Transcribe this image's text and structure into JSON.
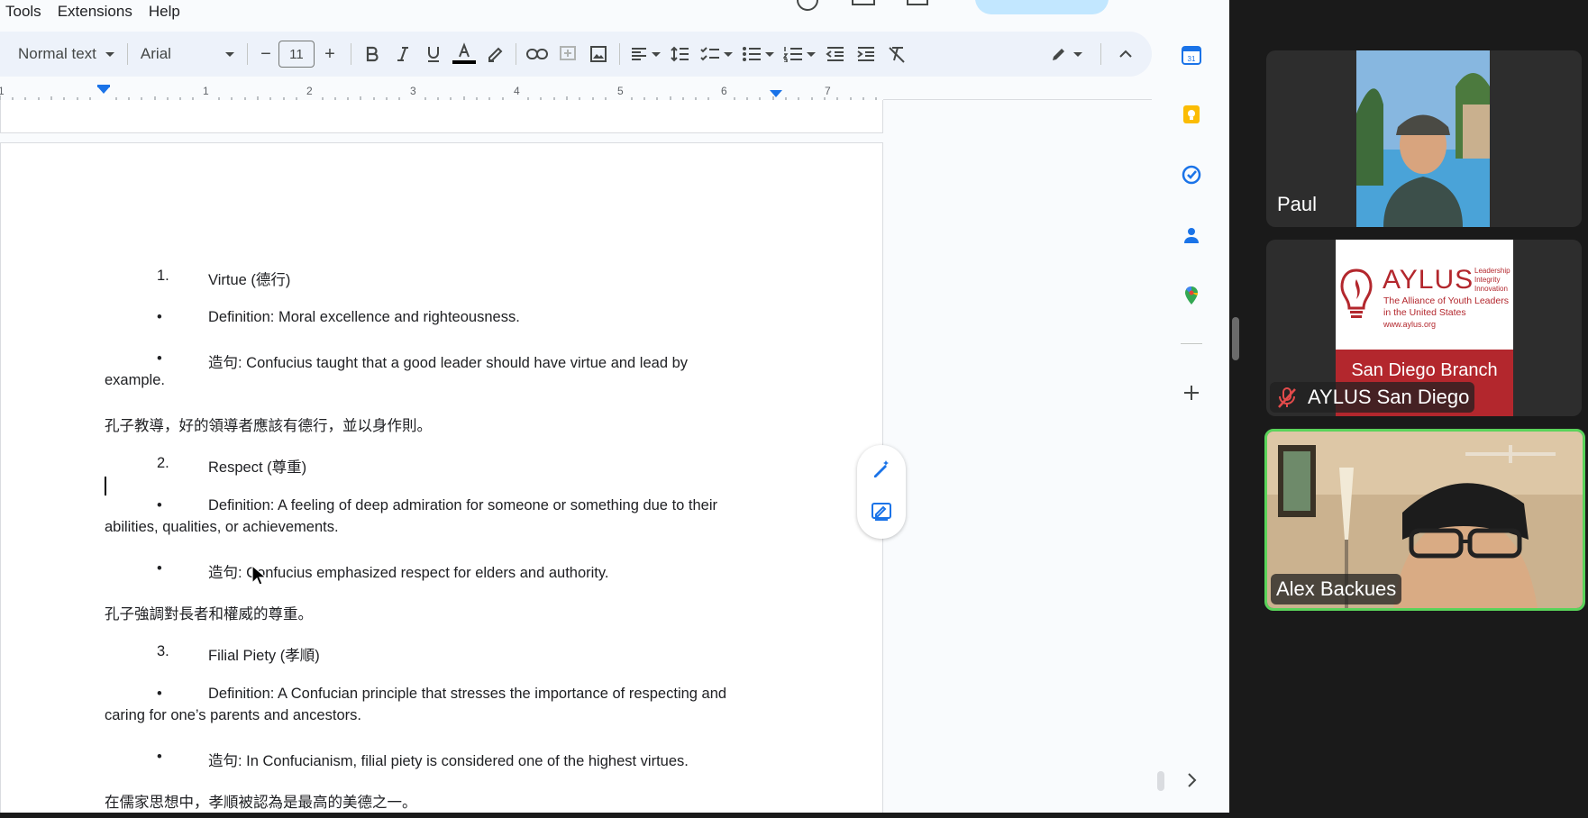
{
  "menu": {
    "items": [
      "Tools",
      "Extensions",
      "Help"
    ]
  },
  "toolbar": {
    "style_label": "Normal text",
    "font_label": "Arial",
    "font_size": "11",
    "minus": "−",
    "plus": "+"
  },
  "ruler": {
    "numbers": [
      "1",
      "1",
      "2",
      "3",
      "4",
      "5",
      "6",
      "7"
    ]
  },
  "doc": {
    "item1_num": "1.",
    "item1_title": "Virtue (德行)",
    "item1_def": "Definition: Moral excellence and righteousness.",
    "item1_ex_a": "造句: Confucius taught that a good leader should have virtue and lead by",
    "item1_ex_b": "example.",
    "item1_zh": "孔子教導，好的領導者應該有德行，並以身作則。",
    "item2_num": "2.",
    "item2_title": "Respect (尊重)",
    "item2_def_a": "Definition: A feeling of deep admiration for someone or something due to their",
    "item2_def_b": "abilities, qualities, or achievements.",
    "item2_ex": "造句: Confucius emphasized respect for elders and authority.",
    "item2_zh": "孔子強調對長者和權威的尊重。",
    "item3_num": "3.",
    "item3_title": "Filial Piety (孝順)",
    "item3_def_a": "Definition: A Confucian principle that stresses the importance of respecting and",
    "item3_def_b": "caring for one’s parents and ancestors.",
    "item3_ex": "造句: In Confucianism, filial piety is considered one of the highest virtues.",
    "item3_zh": "在儒家思想中，孝順被認為是最高的美德之一。",
    "bullet": "•"
  },
  "participants": {
    "paul": "Paul",
    "aylus": "AYLUS San Diego",
    "alex": "Alex Backues"
  },
  "aylus_logo": {
    "brand": "AYLUS",
    "tagline_1": "Leadership",
    "tagline_2": "Integrity",
    "tagline_3": "Innovation",
    "subtitle_1": "The Alliance of Youth Leaders",
    "subtitle_2": "in the United States",
    "url": "www.aylus.org",
    "branch": "San Diego Branch"
  },
  "colors": {
    "accent_blue": "#1a73e8",
    "active_speaker": "#5ad35a",
    "aylus_red": "#b3272d"
  }
}
